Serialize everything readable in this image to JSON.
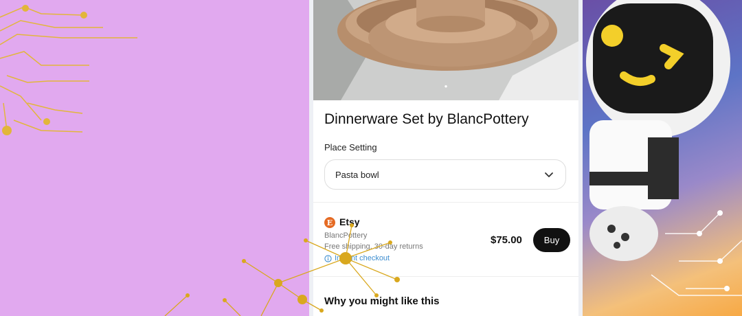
{
  "product": {
    "title": "Dinnerware Set by BlancPottery",
    "option_label": "Place Setting",
    "option_value": "Pasta bowl",
    "carousel_dots": "●"
  },
  "offer": {
    "merchant": "Etsy",
    "merchant_logo_letter": "E",
    "seller": "BlancPottery",
    "shipping": "Free shipping, 30-day returns",
    "checkout": "Instant checkout",
    "price": "$75.00",
    "buy_label": "Buy"
  },
  "section": {
    "why_title": "Why you might like this"
  },
  "colors": {
    "background_left": "#e1a9ef",
    "circuit_gold": "#e2b63a",
    "buy_button": "#111111",
    "merchant_logo": "#e56a23",
    "link_blue": "#3e8ed0"
  }
}
